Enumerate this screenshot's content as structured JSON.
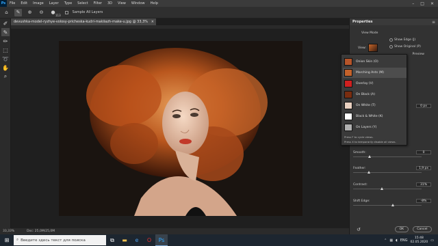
{
  "menubar": {
    "logo": "Ps",
    "items": [
      "File",
      "Edit",
      "Image",
      "Layer",
      "Type",
      "Select",
      "Filter",
      "3D",
      "View",
      "Window",
      "Help"
    ],
    "controls": [
      "–",
      "□",
      "✕"
    ]
  },
  "options_bar": {
    "brush_size": "113",
    "sample_all_layers_label": "Sample All Layers"
  },
  "document": {
    "tab_title": "devushka-model-ryzhye-volosy-pricheska-kudri-makiiazh-make-u.jpg @ 33,3% (RGB/8*)",
    "zoom": "33,33%",
    "doc_info": "Doc: 25,0M/25,0M"
  },
  "properties_panel": {
    "title": "Properties",
    "view_mode_label": "View Mode",
    "view_label": "View:",
    "show_edge_label": "Show Edge (J)",
    "show_original_label": "Show Original (P)",
    "preview_label": "Preview",
    "radius_value": "0 px",
    "smooth_label": "Smooth:",
    "smooth_value": "0",
    "feather_label": "Feather:",
    "feather_value": "1,9 px",
    "contrast_label": "Contrast:",
    "contrast_value": "31%",
    "shift_edge_label": "Shift Edge:",
    "shift_edge_value": "-8%",
    "ok_label": "OK",
    "cancel_label": "Cancel"
  },
  "view_dropdown": {
    "items": [
      {
        "label": "Onion Skin (O)",
        "color": "#b5552a"
      },
      {
        "label": "Marching Ants (M)",
        "color": "#c4622b"
      },
      {
        "label": "Overlay (V)",
        "color": "#d02020"
      },
      {
        "label": "On Black (A)",
        "color": "#7a2d10"
      },
      {
        "label": "On White (T)",
        "color": "#e9d0c0"
      },
      {
        "label": "Black & White (K)",
        "color": "#ffffff"
      },
      {
        "label": "On Layers (Y)",
        "color": "#b0b0b0"
      }
    ],
    "hint_1": "Press F to cycle views.",
    "hint_2": "Press X to temporarily disable all views."
  },
  "taskbar": {
    "search_placeholder": "Введите здесь текст для поиска",
    "language": "ENG",
    "time": "15:48",
    "date": "02.05.2020"
  }
}
